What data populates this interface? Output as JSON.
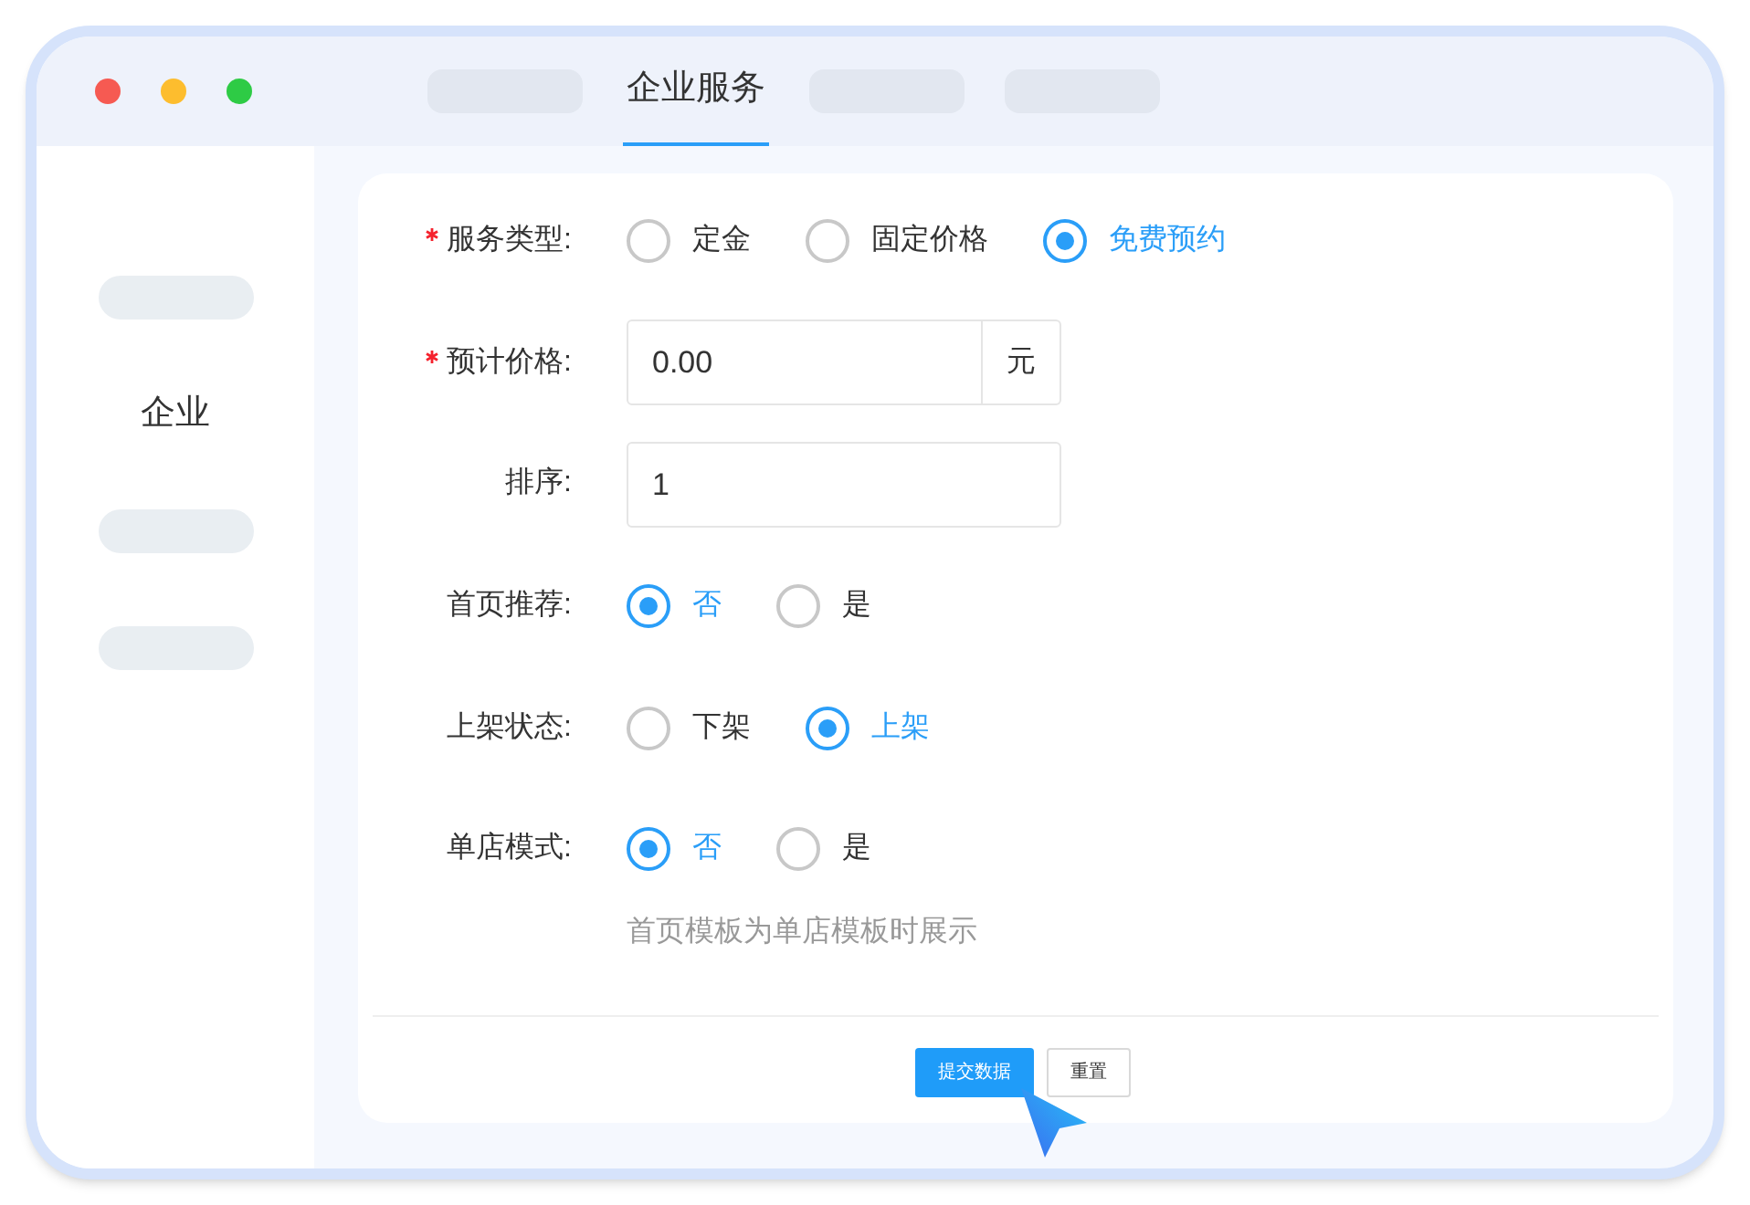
{
  "window": {
    "traffic_lights": [
      {
        "color": "#f65a52"
      },
      {
        "color": "#fdbd2e"
      },
      {
        "color": "#2ecb45"
      }
    ]
  },
  "tabs": [
    {
      "kind": "placeholder",
      "selected": false
    },
    {
      "kind": "label",
      "label": "企业服务",
      "selected": true
    },
    {
      "kind": "placeholder",
      "selected": false
    },
    {
      "kind": "placeholder",
      "selected": false
    }
  ],
  "sidebar": {
    "items": [
      {
        "kind": "placeholder"
      },
      {
        "kind": "label",
        "label": "企业"
      },
      {
        "kind": "placeholder"
      },
      {
        "kind": "placeholder"
      }
    ]
  },
  "form": {
    "rows": [
      {
        "kind": "radio",
        "label": "服务类型:",
        "required": true,
        "options": [
          {
            "label": "定金",
            "selected": false
          },
          {
            "label": "固定价格",
            "selected": false
          },
          {
            "label": "免费预约",
            "selected": true
          }
        ]
      },
      {
        "kind": "input",
        "label": "预计价格:",
        "required": true,
        "value": "0.00",
        "suffix": "元"
      },
      {
        "kind": "input",
        "label": "排序:",
        "required": false,
        "value": "1"
      },
      {
        "kind": "radio",
        "label": "首页推荐:",
        "required": false,
        "options": [
          {
            "label": "否",
            "selected": true
          },
          {
            "label": "是",
            "selected": false
          }
        ]
      },
      {
        "kind": "radio",
        "label": "上架状态:",
        "required": false,
        "options": [
          {
            "label": "下架",
            "selected": false
          },
          {
            "label": "上架",
            "selected": true
          }
        ]
      },
      {
        "kind": "radio",
        "label": "单店模式:",
        "required": false,
        "options": [
          {
            "label": "否",
            "selected": true
          },
          {
            "label": "是",
            "selected": false
          }
        ]
      }
    ],
    "hint": "首页模板为单店模板时展示",
    "buttons": [
      {
        "kind": "primary",
        "label": "提交数据"
      },
      {
        "kind": "default",
        "label": "重置"
      }
    ]
  }
}
